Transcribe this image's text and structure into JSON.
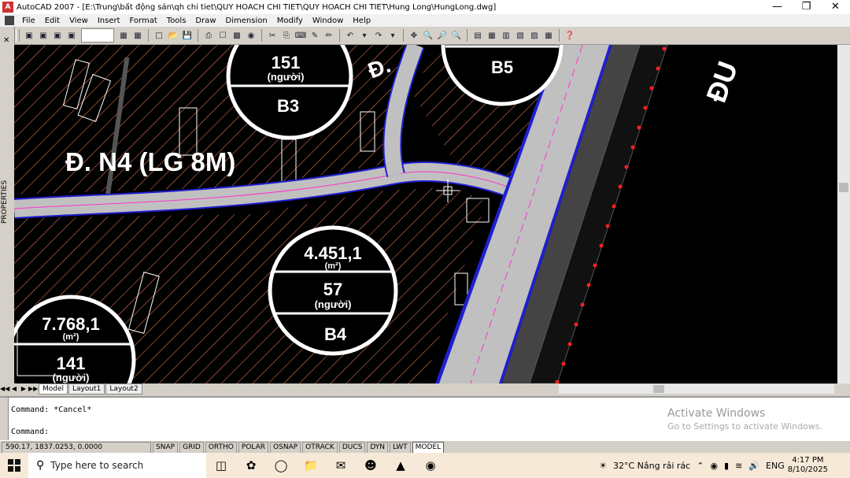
{
  "window": {
    "title": "AutoCAD 2007 - [E:\\Trung\\bất động sản\\qh chi tiet\\QUY HOACH CHI TIET\\QUY HOACH CHI TIET\\Hung Long\\HungLong.dwg]",
    "minimize_icon": "minimize-icon",
    "restore_icon": "restore-icon",
    "close_icon": "close-icon"
  },
  "menu": [
    "File",
    "Edit",
    "View",
    "Insert",
    "Format",
    "Tools",
    "Draw",
    "Dimension",
    "Modify",
    "Window",
    "Help"
  ],
  "palette": {
    "label": "PROPERTIES"
  },
  "drawing": {
    "road_label": "Đ. N4 (LG 8M)",
    "road_label_partial": "Đ.",
    "road_label_right": "ĐU",
    "lots": [
      {
        "id": "B3",
        "people": "151",
        "people_unit": "(người)"
      },
      {
        "id": "B5"
      },
      {
        "id": "B4",
        "area": "4.451,1",
        "area_unit": "(m²)",
        "people": "57",
        "people_unit": "(người)"
      },
      {
        "area": "7.768,1",
        "area_unit": "(m²)",
        "people": "141",
        "people_unit": "(người)"
      }
    ],
    "colors": {
      "road": "#c0c0c0",
      "road_edge": "#1f1fd0",
      "centerline": "#ff33cc",
      "hatch": "#ff8a5c",
      "markers": "#ff2020",
      "label": "#ffffff"
    }
  },
  "layout_tabs": [
    "Model",
    "Layout1",
    "Layout2"
  ],
  "command": {
    "history": "Command: *Cancel*",
    "prompt": "Command:"
  },
  "activate": {
    "title": "Activate Windows",
    "subtitle": "Go to Settings to activate Windows."
  },
  "status": {
    "coords": "590.17, 1837.0253, 0.0000",
    "toggles": [
      "SNAP",
      "GRID",
      "ORTHO",
      "POLAR",
      "OSNAP",
      "OTRACK",
      "DUCS",
      "DYN",
      "LWT",
      "MODEL"
    ]
  },
  "taskbar": {
    "search_placeholder": "Type here to search",
    "weather": "32°C  Nắng rải rác",
    "language": "ENG",
    "time": "4:17 PM",
    "date": "8/10/2025"
  }
}
